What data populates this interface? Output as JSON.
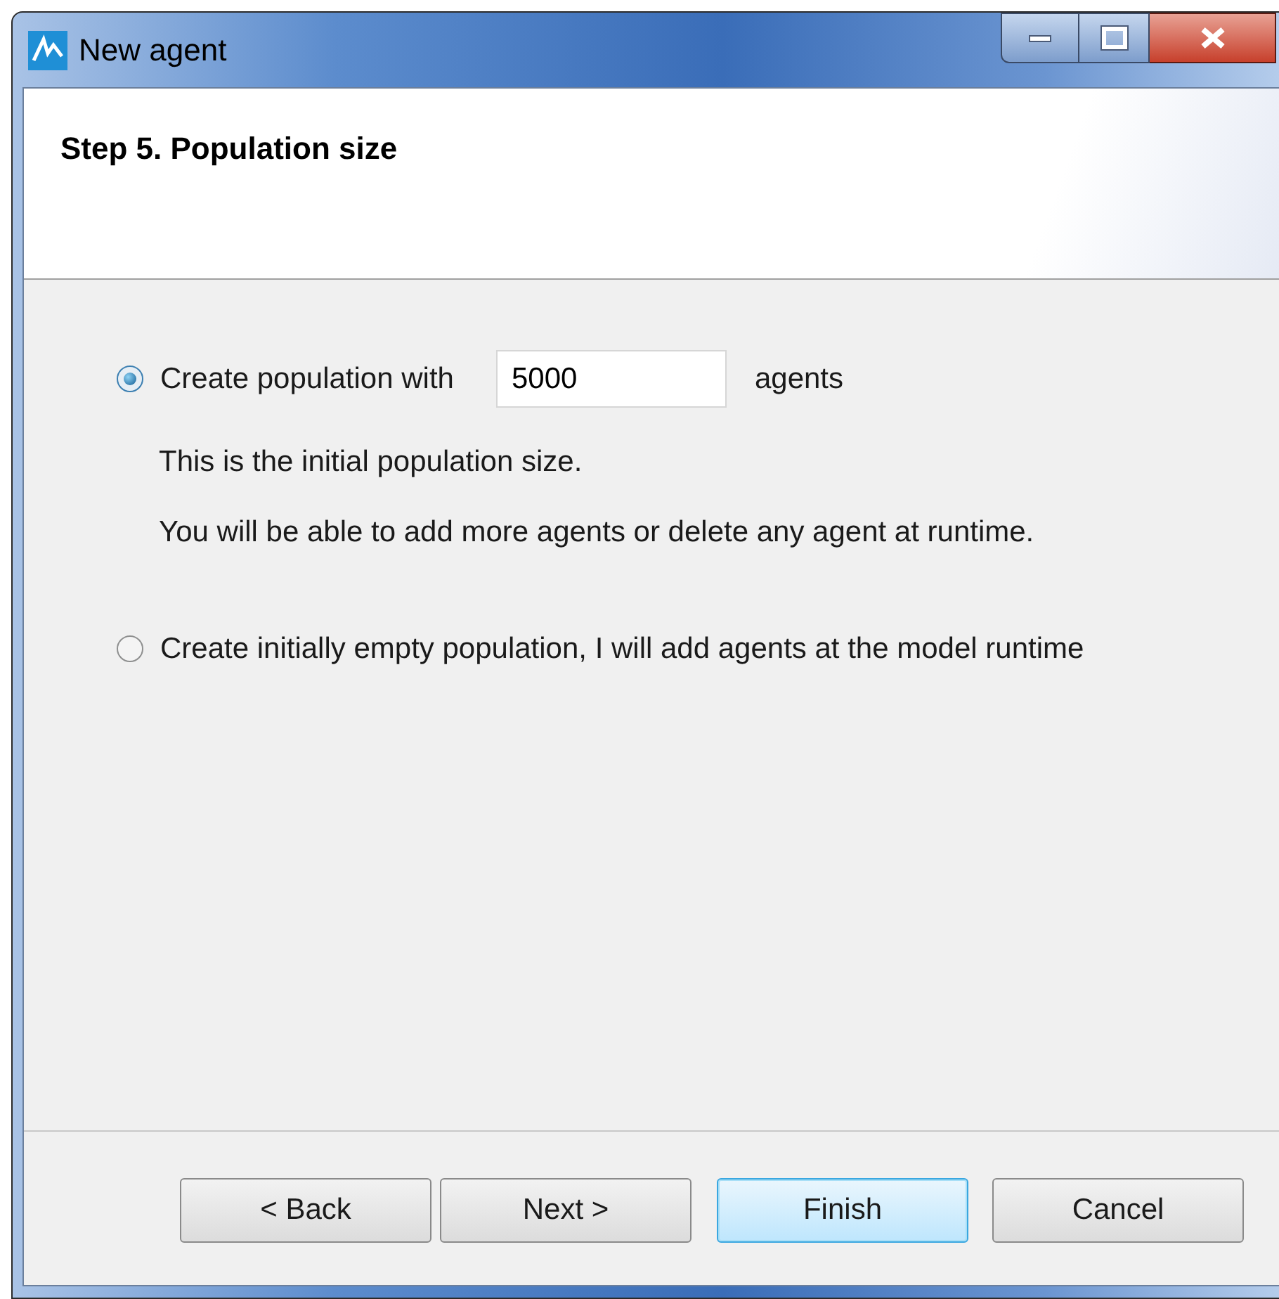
{
  "window": {
    "title": "New agent"
  },
  "header": {
    "title": "Step 5. Population size"
  },
  "options": [
    {
      "kind": "count",
      "label": "Create population with",
      "selected": true,
      "value": "5000",
      "suffix": "agents",
      "notes": [
        "This is the initial population size.",
        "You will be able to add more agents or delete any agent at runtime."
      ]
    },
    {
      "kind": "plain",
      "label": "Create initially empty population, I will add agents at the model runtime",
      "selected": false
    }
  ],
  "buttons": [
    {
      "label": "< Back",
      "default": false
    },
    {
      "label": "Next >",
      "default": false
    },
    {
      "label": "Finish",
      "default": true
    },
    {
      "label": "Cancel",
      "default": false
    }
  ]
}
